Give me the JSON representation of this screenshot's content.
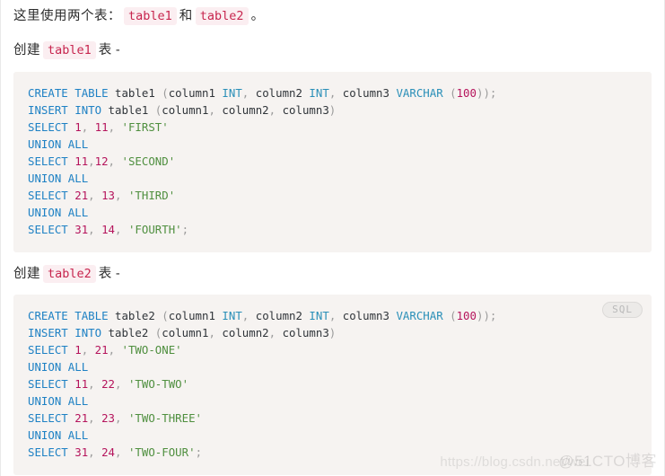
{
  "page": {
    "background_color": "#ffffff",
    "code_block_bg": "#f6f3f1",
    "inline_code_color": "#c7254e",
    "inline_code_bg": "#fbeef1"
  },
  "paragraphs": {
    "intro": {
      "lead": "这里使用两个表：",
      "code_1": "table1",
      "conjunction": "和",
      "code_2": "table2",
      "period": "。"
    },
    "heading_1": {
      "lead": "创建",
      "code": "table1",
      "trail": "表",
      "dash": "-"
    },
    "heading_2": {
      "lead": "创建",
      "code": "table2",
      "trail": "表",
      "dash": "-"
    }
  },
  "code_blocks": [
    {
      "language": "sql",
      "badge": null,
      "lines": [
        [
          {
            "t": "CREATE",
            "c": "kw"
          },
          {
            "t": " ",
            "c": "id"
          },
          {
            "t": "TABLE",
            "c": "kw"
          },
          {
            "t": " ",
            "c": "id"
          },
          {
            "t": "table1",
            "c": "id"
          },
          {
            "t": " ",
            "c": "id"
          },
          {
            "t": "(",
            "c": "punc"
          },
          {
            "t": "column1",
            "c": "id"
          },
          {
            "t": " ",
            "c": "id"
          },
          {
            "t": "INT",
            "c": "kw2"
          },
          {
            "t": ",",
            "c": "punc"
          },
          {
            "t": " ",
            "c": "id"
          },
          {
            "t": "column2",
            "c": "id"
          },
          {
            "t": " ",
            "c": "id"
          },
          {
            "t": "INT",
            "c": "kw2"
          },
          {
            "t": ",",
            "c": "punc"
          },
          {
            "t": " ",
            "c": "id"
          },
          {
            "t": "column3",
            "c": "id"
          },
          {
            "t": " ",
            "c": "id"
          },
          {
            "t": "VARCHAR",
            "c": "kw2"
          },
          {
            "t": " ",
            "c": "id"
          },
          {
            "t": "(",
            "c": "punc"
          },
          {
            "t": "100",
            "c": "num"
          },
          {
            "t": "))",
            "c": "punc"
          },
          {
            "t": ";",
            "c": "punc"
          }
        ],
        [
          {
            "t": "INSERT",
            "c": "kw"
          },
          {
            "t": " ",
            "c": "id"
          },
          {
            "t": "INTO",
            "c": "kw"
          },
          {
            "t": " ",
            "c": "id"
          },
          {
            "t": "table1",
            "c": "id"
          },
          {
            "t": " ",
            "c": "id"
          },
          {
            "t": "(",
            "c": "punc"
          },
          {
            "t": "column1",
            "c": "id"
          },
          {
            "t": ",",
            "c": "punc"
          },
          {
            "t": " ",
            "c": "id"
          },
          {
            "t": "column2",
            "c": "id"
          },
          {
            "t": ",",
            "c": "punc"
          },
          {
            "t": " ",
            "c": "id"
          },
          {
            "t": "column3",
            "c": "id"
          },
          {
            "t": ")",
            "c": "punc"
          }
        ],
        [
          {
            "t": "SELECT",
            "c": "kw"
          },
          {
            "t": " ",
            "c": "id"
          },
          {
            "t": "1",
            "c": "num"
          },
          {
            "t": ",",
            "c": "punc"
          },
          {
            "t": " ",
            "c": "id"
          },
          {
            "t": "11",
            "c": "num"
          },
          {
            "t": ",",
            "c": "punc"
          },
          {
            "t": " ",
            "c": "id"
          },
          {
            "t": "'FIRST'",
            "c": "str"
          }
        ],
        [
          {
            "t": "UNION",
            "c": "kw"
          },
          {
            "t": " ",
            "c": "id"
          },
          {
            "t": "ALL",
            "c": "kw"
          }
        ],
        [
          {
            "t": "SELECT",
            "c": "kw"
          },
          {
            "t": " ",
            "c": "id"
          },
          {
            "t": "11",
            "c": "num"
          },
          {
            "t": ",",
            "c": "punc"
          },
          {
            "t": "12",
            "c": "num"
          },
          {
            "t": ",",
            "c": "punc"
          },
          {
            "t": " ",
            "c": "id"
          },
          {
            "t": "'SECOND'",
            "c": "str"
          }
        ],
        [
          {
            "t": "UNION",
            "c": "kw"
          },
          {
            "t": " ",
            "c": "id"
          },
          {
            "t": "ALL",
            "c": "kw"
          }
        ],
        [
          {
            "t": "SELECT",
            "c": "kw"
          },
          {
            "t": " ",
            "c": "id"
          },
          {
            "t": "21",
            "c": "num"
          },
          {
            "t": ",",
            "c": "punc"
          },
          {
            "t": " ",
            "c": "id"
          },
          {
            "t": "13",
            "c": "num"
          },
          {
            "t": ",",
            "c": "punc"
          },
          {
            "t": " ",
            "c": "id"
          },
          {
            "t": "'THIRD'",
            "c": "str"
          }
        ],
        [
          {
            "t": "UNION",
            "c": "kw"
          },
          {
            "t": " ",
            "c": "id"
          },
          {
            "t": "ALL",
            "c": "kw"
          }
        ],
        [
          {
            "t": "SELECT",
            "c": "kw"
          },
          {
            "t": " ",
            "c": "id"
          },
          {
            "t": "31",
            "c": "num"
          },
          {
            "t": ",",
            "c": "punc"
          },
          {
            "t": " ",
            "c": "id"
          },
          {
            "t": "14",
            "c": "num"
          },
          {
            "t": ",",
            "c": "punc"
          },
          {
            "t": " ",
            "c": "id"
          },
          {
            "t": "'FOURTH'",
            "c": "str"
          },
          {
            "t": ";",
            "c": "punc"
          }
        ]
      ]
    },
    {
      "language": "sql",
      "badge": "SQL",
      "lines": [
        [
          {
            "t": "CREATE",
            "c": "kw"
          },
          {
            "t": " ",
            "c": "id"
          },
          {
            "t": "TABLE",
            "c": "kw"
          },
          {
            "t": " ",
            "c": "id"
          },
          {
            "t": "table2",
            "c": "id"
          },
          {
            "t": " ",
            "c": "id"
          },
          {
            "t": "(",
            "c": "punc"
          },
          {
            "t": "column1",
            "c": "id"
          },
          {
            "t": " ",
            "c": "id"
          },
          {
            "t": "INT",
            "c": "kw2"
          },
          {
            "t": ",",
            "c": "punc"
          },
          {
            "t": " ",
            "c": "id"
          },
          {
            "t": "column2",
            "c": "id"
          },
          {
            "t": " ",
            "c": "id"
          },
          {
            "t": "INT",
            "c": "kw2"
          },
          {
            "t": ",",
            "c": "punc"
          },
          {
            "t": " ",
            "c": "id"
          },
          {
            "t": "column3",
            "c": "id"
          },
          {
            "t": " ",
            "c": "id"
          },
          {
            "t": "VARCHAR",
            "c": "kw2"
          },
          {
            "t": " ",
            "c": "id"
          },
          {
            "t": "(",
            "c": "punc"
          },
          {
            "t": "100",
            "c": "num"
          },
          {
            "t": "))",
            "c": "punc"
          },
          {
            "t": ";",
            "c": "punc"
          }
        ],
        [
          {
            "t": "INSERT",
            "c": "kw"
          },
          {
            "t": " ",
            "c": "id"
          },
          {
            "t": "INTO",
            "c": "kw"
          },
          {
            "t": " ",
            "c": "id"
          },
          {
            "t": "table2",
            "c": "id"
          },
          {
            "t": " ",
            "c": "id"
          },
          {
            "t": "(",
            "c": "punc"
          },
          {
            "t": "column1",
            "c": "id"
          },
          {
            "t": ",",
            "c": "punc"
          },
          {
            "t": " ",
            "c": "id"
          },
          {
            "t": "column2",
            "c": "id"
          },
          {
            "t": ",",
            "c": "punc"
          },
          {
            "t": " ",
            "c": "id"
          },
          {
            "t": "column3",
            "c": "id"
          },
          {
            "t": ")",
            "c": "punc"
          }
        ],
        [
          {
            "t": "SELECT",
            "c": "kw"
          },
          {
            "t": " ",
            "c": "id"
          },
          {
            "t": "1",
            "c": "num"
          },
          {
            "t": ",",
            "c": "punc"
          },
          {
            "t": " ",
            "c": "id"
          },
          {
            "t": "21",
            "c": "num"
          },
          {
            "t": ",",
            "c": "punc"
          },
          {
            "t": " ",
            "c": "id"
          },
          {
            "t": "'TWO-ONE'",
            "c": "str"
          }
        ],
        [
          {
            "t": "UNION",
            "c": "kw"
          },
          {
            "t": " ",
            "c": "id"
          },
          {
            "t": "ALL",
            "c": "kw"
          }
        ],
        [
          {
            "t": "SELECT",
            "c": "kw"
          },
          {
            "t": " ",
            "c": "id"
          },
          {
            "t": "11",
            "c": "num"
          },
          {
            "t": ",",
            "c": "punc"
          },
          {
            "t": " ",
            "c": "id"
          },
          {
            "t": "22",
            "c": "num"
          },
          {
            "t": ",",
            "c": "punc"
          },
          {
            "t": " ",
            "c": "id"
          },
          {
            "t": "'TWO-TWO'",
            "c": "str"
          }
        ],
        [
          {
            "t": "UNION",
            "c": "kw"
          },
          {
            "t": " ",
            "c": "id"
          },
          {
            "t": "ALL",
            "c": "kw"
          }
        ],
        [
          {
            "t": "SELECT",
            "c": "kw"
          },
          {
            "t": " ",
            "c": "id"
          },
          {
            "t": "21",
            "c": "num"
          },
          {
            "t": ",",
            "c": "punc"
          },
          {
            "t": " ",
            "c": "id"
          },
          {
            "t": "23",
            "c": "num"
          },
          {
            "t": ",",
            "c": "punc"
          },
          {
            "t": " ",
            "c": "id"
          },
          {
            "t": "'TWO-THREE'",
            "c": "str"
          }
        ],
        [
          {
            "t": "UNION",
            "c": "kw"
          },
          {
            "t": " ",
            "c": "id"
          },
          {
            "t": "ALL",
            "c": "kw"
          }
        ],
        [
          {
            "t": "SELECT",
            "c": "kw"
          },
          {
            "t": " ",
            "c": "id"
          },
          {
            "t": "31",
            "c": "num"
          },
          {
            "t": ",",
            "c": "punc"
          },
          {
            "t": " ",
            "c": "id"
          },
          {
            "t": "24",
            "c": "num"
          },
          {
            "t": ",",
            "c": "punc"
          },
          {
            "t": " ",
            "c": "id"
          },
          {
            "t": "'TWO-FOUR'",
            "c": "str"
          },
          {
            "t": ";",
            "c": "punc"
          }
        ]
      ]
    }
  ],
  "watermark": {
    "url": "https://blog.csdn.net/wei",
    "brand": "@51CTO博客"
  }
}
